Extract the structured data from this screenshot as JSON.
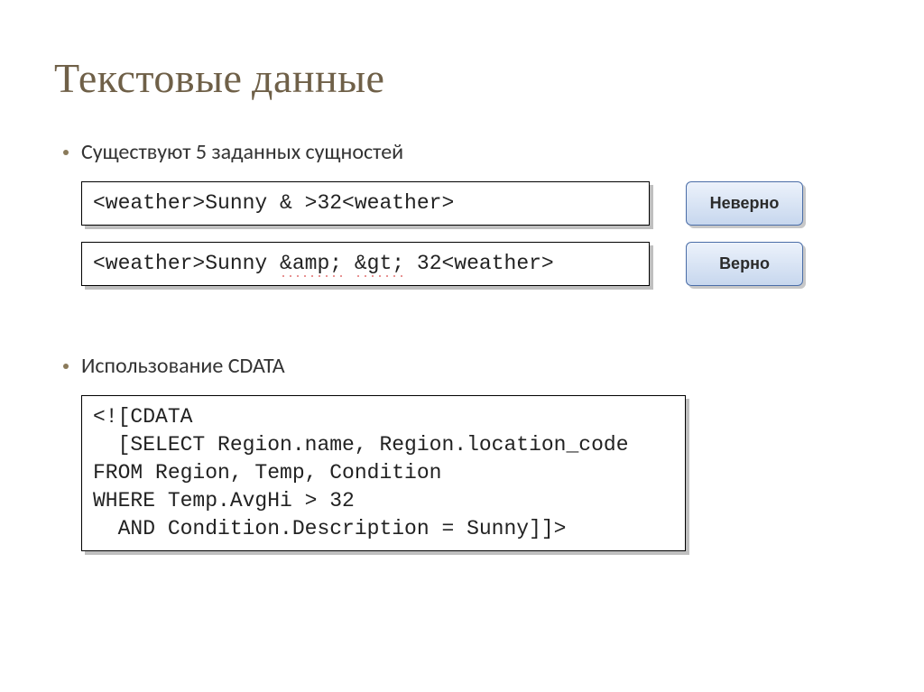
{
  "title": "Текстовые данные",
  "bullets": {
    "entities": "Существуют 5 заданных сущностей",
    "cdata": "Использование CDATA"
  },
  "examples": {
    "wrong": {
      "pre": "<weather>Sunny & >32<weather>",
      "label": "Неверно"
    },
    "right": {
      "segments": {
        "a": "<weather>Sunny ",
        "amp": "&amp;",
        "b": " ",
        "gt": "&gt;",
        "c": " 32<weather>"
      },
      "label": "Верно"
    }
  },
  "cdata_block": "<![CDATA\n  [SELECT Region.name, Region.location_code\nFROM Region, Temp, Condition\nWHERE Temp.AvgHi > 32\n  AND Condition.Description = Sunny]]>"
}
